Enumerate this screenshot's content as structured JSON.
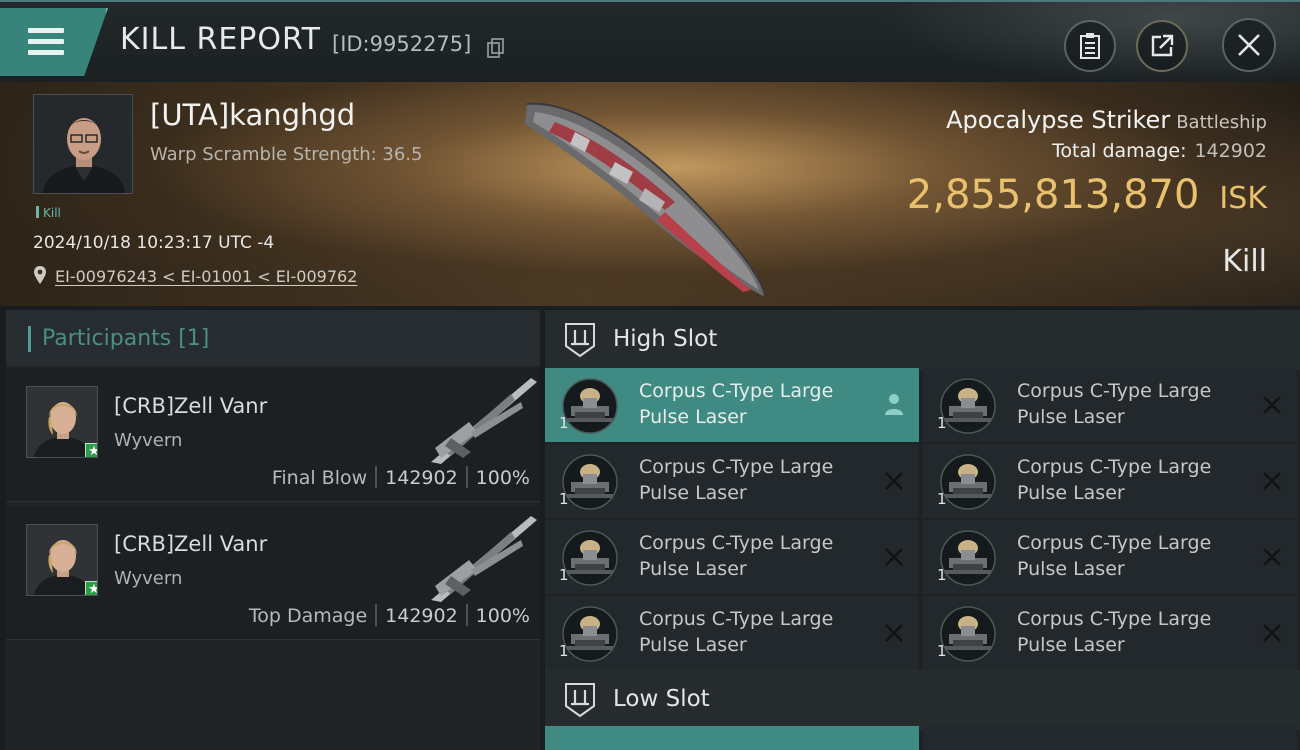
{
  "header": {
    "title": "KILL REPORT",
    "kill_id": "[ID:9952275]",
    "icons": {
      "menu": "hamburger-menu-icon",
      "copy": "copy-icon",
      "clipboard": "clipboard-icon",
      "share": "share-icon",
      "close": "close-icon"
    }
  },
  "victim": {
    "name": "[UTA]kanghgd",
    "warp_scramble": "Warp Scramble Strength: 36.5",
    "tag": "Kill",
    "datetime": "2024/10/18 10:23:17 UTC -4",
    "location": "EI-00976243 < EI-01001 < EI-009762"
  },
  "ship": {
    "name": "Apocalypse Striker",
    "class": "Battleship",
    "total_damage_label": "Total damage:",
    "total_damage": "142902",
    "isk_value": "2,855,813,870",
    "isk_unit": "ISK",
    "result": "Kill"
  },
  "participants": {
    "title": "Participants [1]",
    "rows": [
      {
        "name": "[CRB]Zell Vanr",
        "ship": "Wyvern",
        "label": "Final Blow",
        "damage": "142902",
        "percent": "100%"
      },
      {
        "name": "[CRB]Zell Vanr",
        "ship": "Wyvern",
        "label": "Top Damage",
        "damage": "142902",
        "percent": "100%"
      }
    ]
  },
  "slots": {
    "high": {
      "title": "High Slot",
      "modules": [
        {
          "line1": "Corpus C-Type Large",
          "line2": "Pulse Laser",
          "qty": "1"
        },
        {
          "line1": "Corpus C-Type Large",
          "line2": "Pulse Laser",
          "qty": "1"
        },
        {
          "line1": "Corpus C-Type Large",
          "line2": "Pulse Laser",
          "qty": "1"
        },
        {
          "line1": "Corpus C-Type Large",
          "line2": "Pulse Laser",
          "qty": "1"
        },
        {
          "line1": "Corpus C-Type Large",
          "line2": "Pulse Laser",
          "qty": "1"
        },
        {
          "line1": "Corpus C-Type Large",
          "line2": "Pulse Laser",
          "qty": "1"
        },
        {
          "line1": "Corpus C-Type Large",
          "line2": "Pulse Laser",
          "qty": "1"
        },
        {
          "line1": "Corpus C-Type Large",
          "line2": "Pulse Laser",
          "qty": "1"
        }
      ]
    },
    "low": {
      "title": "Low Slot"
    }
  },
  "colors": {
    "accent": "#3f8a82",
    "isk": "#e9c16d",
    "background": "#1a1d20"
  }
}
